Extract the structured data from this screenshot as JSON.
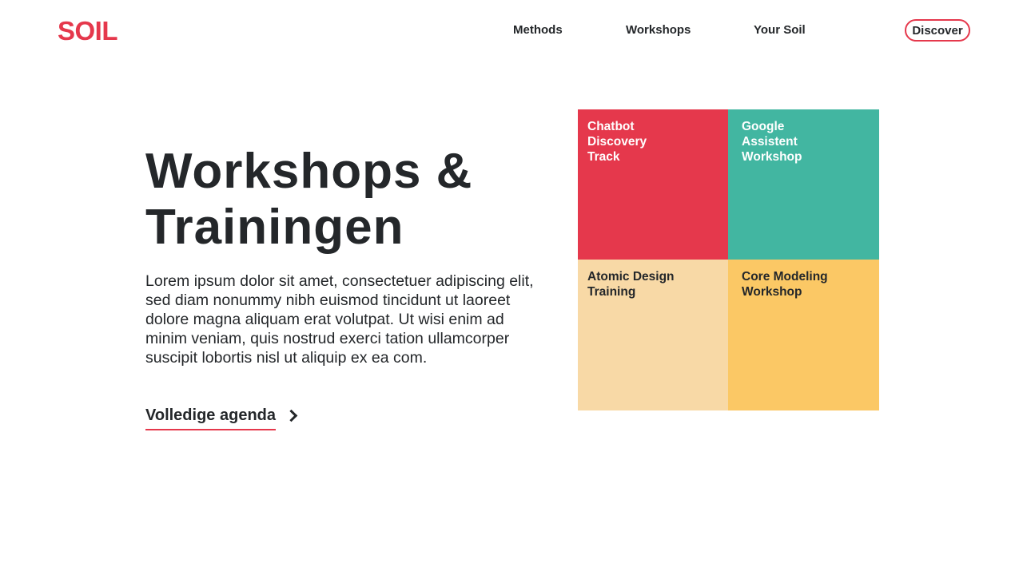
{
  "header": {
    "logo": "SOIL",
    "nav": [
      {
        "label": "Methods"
      },
      {
        "label": "Workshops"
      },
      {
        "label": "Your Soil"
      }
    ],
    "cta_label": "Discover"
  },
  "hero": {
    "title": "Workshops & Trainingen",
    "body": "Lorem ipsum dolor sit amet, consectetuer adipiscing elit, sed diam nonummy nibh euismod tincidunt ut laoreet dolore magna aliquam erat volutpat. Ut wisi enim ad minim veniam, quis nostrud exerci tation ullamcorper suscipit lobortis nisl ut aliquip ex ea com.",
    "link_label": "Volledige agenda"
  },
  "tiles": [
    {
      "label": "Chatbot Discovery Track",
      "color": "#e5384c"
    },
    {
      "label": "Google Assistent Workshop",
      "color": "#42b6a1"
    },
    {
      "label": "Atomic Design Training",
      "color": "#f8d9a6"
    },
    {
      "label": "Core Modeling Workshop",
      "color": "#fbc865"
    }
  ],
  "colors": {
    "brand": "#e5384c",
    "text": "#24272a",
    "background": "#ffffff"
  }
}
